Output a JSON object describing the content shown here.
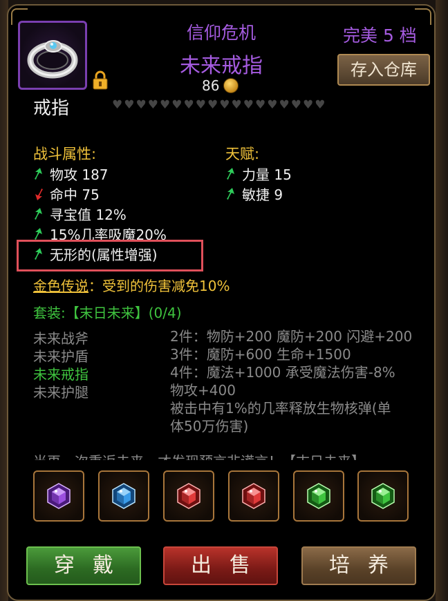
{
  "header": {
    "set_name": "信仰危机",
    "item_name": "未来戒指",
    "level": "86",
    "grade": "完美 5 档",
    "store_button": "存入仓库",
    "item_type": "戒指",
    "hearts_total": 18
  },
  "combat": {
    "title": "战斗属性:",
    "stats": [
      {
        "text": "物攻 187",
        "dir": "up"
      },
      {
        "text": "命中 75",
        "dir": "down"
      },
      {
        "text": "寻宝值 12%",
        "dir": "up"
      },
      {
        "text": "15%几率吸魔20%",
        "dir": "up"
      },
      {
        "text": "无形的(属性增强)",
        "dir": "up"
      }
    ]
  },
  "talent": {
    "title": "天赋:",
    "stats": [
      {
        "text": "力量 15",
        "dir": "up"
      },
      {
        "text": "敏捷 9",
        "dir": "up"
      }
    ]
  },
  "legend": {
    "label": "金色传说",
    "text": "：受到的伤害减免10%"
  },
  "set": {
    "title": "套装:【末日未来】(0/4)",
    "pieces": [
      {
        "name": "未来战斧",
        "active": false
      },
      {
        "name": "未来护盾",
        "active": false
      },
      {
        "name": "未来戒指",
        "active": true
      },
      {
        "name": "未来护腿",
        "active": false
      }
    ],
    "bonuses": [
      "2件：物防+200 魔防+200 闪避+200",
      "3件：魔防+600 生命+1500",
      "4件：魔法+1000 承受魔法伤害-8%",
      "物攻+400",
      "被击中有1%的几率释放生物核弹(单",
      "体50万伤害)"
    ],
    "lore": "当再一次重返未来，才发现预言非谎言！【末日未来】"
  },
  "gems": [
    {
      "color": "#9b4fe0",
      "light": "#d9b2ff",
      "dark": "#4a1a7a"
    },
    {
      "color": "#3a9be8",
      "light": "#b8e4ff",
      "dark": "#12467a"
    },
    {
      "color": "#e03a3a",
      "light": "#ffb0b0",
      "dark": "#6e1010"
    },
    {
      "color": "#e03a3a",
      "light": "#ffb0b0",
      "dark": "#6e1010"
    },
    {
      "color": "#3fc43f",
      "light": "#b8ffb0",
      "dark": "#145a14"
    },
    {
      "color": "#3fc43f",
      "light": "#b8ffb0",
      "dark": "#145a14"
    }
  ],
  "actions": {
    "wear": "穿戴",
    "sell": "出售",
    "train": "培养"
  }
}
